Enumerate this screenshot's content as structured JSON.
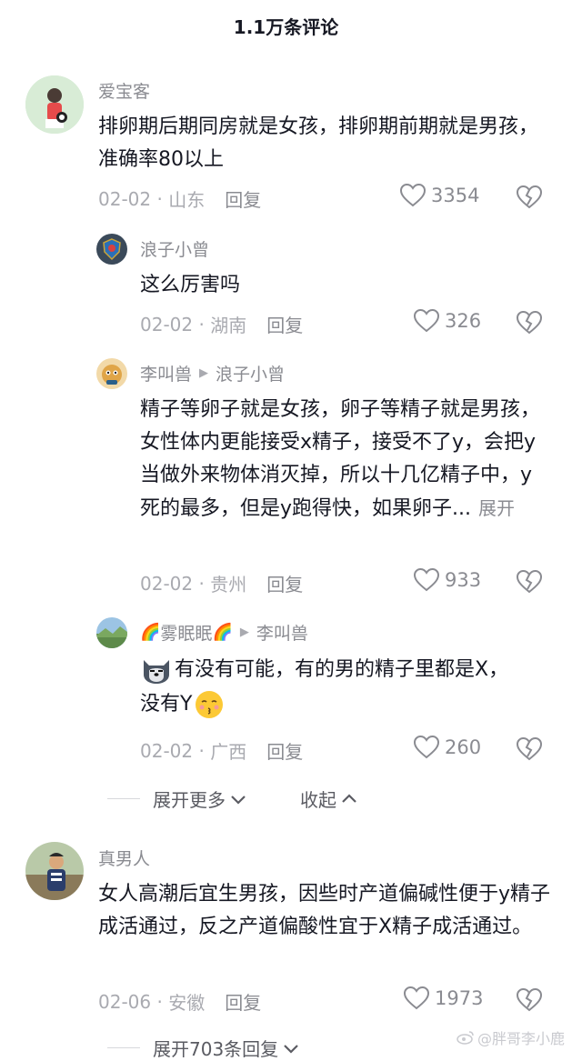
{
  "header": {
    "title": "1.1万条评论"
  },
  "comments": [
    {
      "user": "爱宝客",
      "text": "排卵期后期同房就是女孩，排卵期前期就是男孩，准确率80以上",
      "date": "02-02",
      "location": "山东",
      "reply_label": "回复",
      "likes": "3354"
    },
    {
      "user": "真男人",
      "text": "女人高潮后宜生男孩，因些时产道偏碱性便于y精子成活通过，反之产道偏酸性宜于X精子成活通过。",
      "date": "02-06",
      "location": "安徽",
      "reply_label": "回复",
      "likes": "1973"
    }
  ],
  "replies": [
    {
      "user": "浪子小曾",
      "reply_to": "",
      "text": "这么厉害吗",
      "date": "02-02",
      "location": "湖南",
      "reply_label": "回复",
      "likes": "326"
    },
    {
      "user": "李叫兽",
      "reply_to": "浪子小曾",
      "text": "精子等卵子就是女孩，卵子等精子就是男孩，女性体内更能接受x精子，接受不了y，会把y当做外来物体消灭掉，所以十几亿精子中，y死的最多，但是y跑得快，如果卵子...",
      "expand": "展开",
      "date": "02-02",
      "location": "贵州",
      "reply_label": "回复",
      "likes": "933"
    },
    {
      "user": "雾眠眠",
      "reply_to": "李叫兽",
      "text_line1": "有没有可能，有的男的精子里都是X，",
      "text_line2": "没有Y",
      "date": "02-02",
      "location": "广西",
      "reply_label": "回复",
      "likes": "260"
    }
  ],
  "thread_controls": {
    "expand_more": "展开更多",
    "collapse": "收起",
    "expand_replies": "展开703条回复"
  },
  "watermark": "@胖哥李小鹿",
  "icons": {
    "like": "heart-outline-icon",
    "dislike": "broken-heart-icon",
    "chevron_down": "chevron-down-icon",
    "chevron_up": "chevron-up-icon",
    "reply_arrow": "triangle-right-icon"
  }
}
